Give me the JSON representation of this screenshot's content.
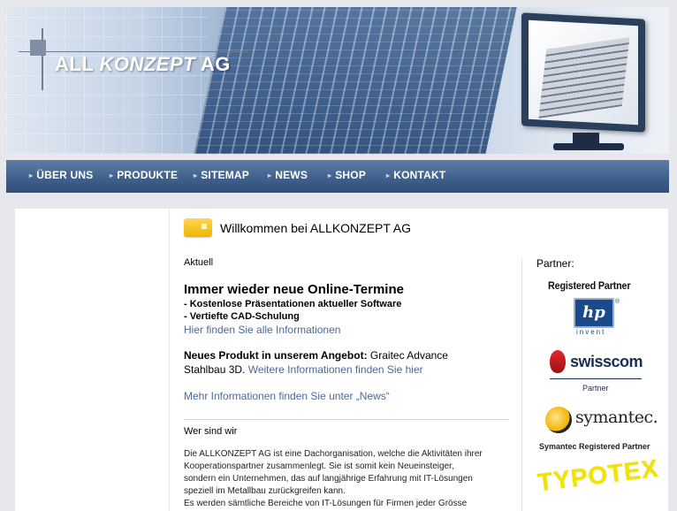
{
  "logo": {
    "part1": "ALL ",
    "part2": "KONZEPT",
    "part3": " AG"
  },
  "nav": [
    {
      "label": "ÜBER UNS"
    },
    {
      "label": "PRODUKTE"
    },
    {
      "label": "SITEMAP"
    },
    {
      "label": "NEWS"
    },
    {
      "label": "SHOP"
    },
    {
      "label": "KONTAKT"
    }
  ],
  "welcome": "Willkommen bei ALLKONZEPT AG",
  "aktuell": "Aktuell",
  "news1": {
    "title": "Immer wieder neue Online-Termine",
    "bullet1": "- Kostenlose Präsentationen aktueller Software",
    "bullet2": "- Vertiefte CAD-Schulung",
    "link": "Hier finden Sie alle Informationen"
  },
  "news2": {
    "bold": "Neues Produkt in unserem Angebot:",
    "text1": " Graitec Advance",
    "text2": "Stahlbau 3D. ",
    "link": "Weitere Informationen finden Sie hier"
  },
  "mehr": "Mehr Informationen finden Sie unter „News“",
  "wer": "Wer sind wir",
  "about": [
    "Die ALLKONZEPT AG ist eine Dachorganisation, welche die Aktivitäten ihrer",
    "Kooperationspartner zusammenlegt. Sie ist somit kein Neueinsteiger,",
    "sondern ein Unternehmen, das auf langjährige Erfahrung mit IT-Lösungen",
    "speziell im Metallbau zurückgreifen kann.",
    "Es werden sämtliche Bereiche von IT-Lösungen für Firmen jeder Grösse"
  ],
  "partners": {
    "label": "Partner:",
    "hp_reg": "Registered Partner",
    "hp_logo": "hp",
    "hp_invent": "invent",
    "swisscom": "swisscom",
    "swisscom_partner": "Partner",
    "symantec": "symantec.",
    "symantec_reg": "Symantec Registered Partner",
    "typotex": "TYPOTEX"
  }
}
